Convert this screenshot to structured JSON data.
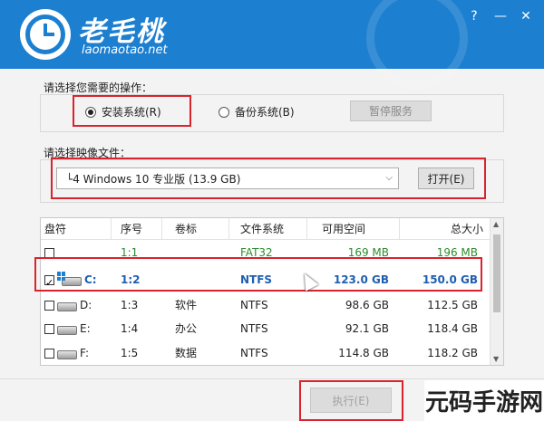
{
  "header": {
    "brand": "老毛桃",
    "domain": "laomaotao.net",
    "window_controls": [
      "?",
      "—",
      "✕"
    ]
  },
  "operation": {
    "prompt": "请选择您需要的操作：",
    "install_label": "安装系统(R)",
    "backup_label": "备份系统(B)",
    "selected": "install",
    "pause_label": "暂停服务"
  },
  "image": {
    "prompt": "请选择映像文件：",
    "selected_value": "└4 Windows 10 专业版 (13.9 GB)",
    "open_label": "打开(E)"
  },
  "table": {
    "headers": [
      "盘符",
      "序号",
      "卷标",
      "文件系统",
      "可用空间",
      "总大小"
    ],
    "rows": [
      {
        "drive": "",
        "index": "1:1",
        "label": "",
        "fs": "FAT32",
        "free": "169 MB",
        "total": "196 MB",
        "checked": false,
        "green": true,
        "icon": false
      },
      {
        "drive": "C:",
        "index": "1:2",
        "label": "",
        "fs": "NTFS",
        "free": "123.0 GB",
        "total": "150.0 GB",
        "checked": true,
        "green": true,
        "icon": true
      },
      {
        "drive": "D:",
        "index": "1:3",
        "label": "软件",
        "fs": "NTFS",
        "free": "98.6 GB",
        "total": "112.5 GB",
        "checked": false,
        "green": false,
        "icon": true
      },
      {
        "drive": "E:",
        "index": "1:4",
        "label": "办公",
        "fs": "NTFS",
        "free": "92.1 GB",
        "total": "118.4 GB",
        "checked": false,
        "green": false,
        "icon": true
      },
      {
        "drive": "F:",
        "index": "1:5",
        "label": "数据",
        "fs": "NTFS",
        "free": "114.8 GB",
        "total": "118.2 GB",
        "checked": false,
        "green": false,
        "icon": true
      }
    ]
  },
  "footer": {
    "execute_label": "执行(E)"
  },
  "watermark": "元码手游网",
  "colors": {
    "header_blue": "#1c7fd0",
    "highlight_red": "#d9232d",
    "green_text": "#2e8b2e",
    "selected_blue_text": "#1f5fb0"
  }
}
